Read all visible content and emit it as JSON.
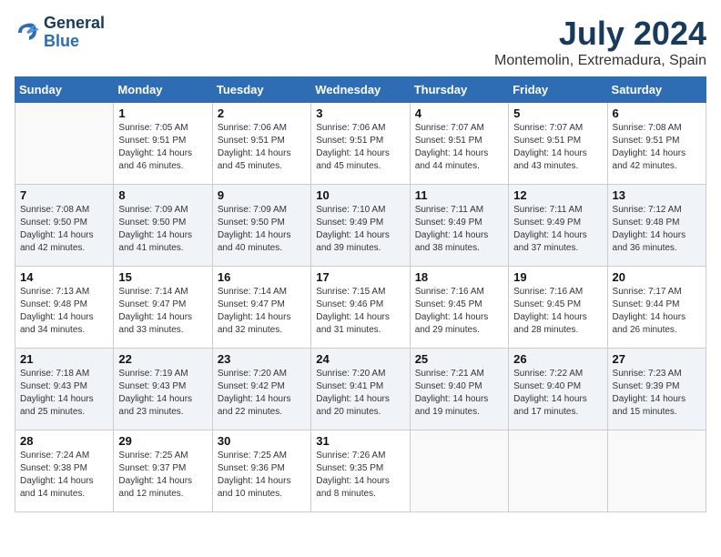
{
  "header": {
    "logo_line1": "General",
    "logo_line2": "Blue",
    "month_year": "July 2024",
    "location": "Montemolin, Extremadura, Spain"
  },
  "days_of_week": [
    "Sunday",
    "Monday",
    "Tuesday",
    "Wednesday",
    "Thursday",
    "Friday",
    "Saturday"
  ],
  "weeks": [
    [
      {
        "day": "",
        "info": ""
      },
      {
        "day": "1",
        "info": "Sunrise: 7:05 AM\nSunset: 9:51 PM\nDaylight: 14 hours\nand 46 minutes."
      },
      {
        "day": "2",
        "info": "Sunrise: 7:06 AM\nSunset: 9:51 PM\nDaylight: 14 hours\nand 45 minutes."
      },
      {
        "day": "3",
        "info": "Sunrise: 7:06 AM\nSunset: 9:51 PM\nDaylight: 14 hours\nand 45 minutes."
      },
      {
        "day": "4",
        "info": "Sunrise: 7:07 AM\nSunset: 9:51 PM\nDaylight: 14 hours\nand 44 minutes."
      },
      {
        "day": "5",
        "info": "Sunrise: 7:07 AM\nSunset: 9:51 PM\nDaylight: 14 hours\nand 43 minutes."
      },
      {
        "day": "6",
        "info": "Sunrise: 7:08 AM\nSunset: 9:51 PM\nDaylight: 14 hours\nand 42 minutes."
      }
    ],
    [
      {
        "day": "7",
        "info": "Sunrise: 7:08 AM\nSunset: 9:50 PM\nDaylight: 14 hours\nand 42 minutes."
      },
      {
        "day": "8",
        "info": "Sunrise: 7:09 AM\nSunset: 9:50 PM\nDaylight: 14 hours\nand 41 minutes."
      },
      {
        "day": "9",
        "info": "Sunrise: 7:09 AM\nSunset: 9:50 PM\nDaylight: 14 hours\nand 40 minutes."
      },
      {
        "day": "10",
        "info": "Sunrise: 7:10 AM\nSunset: 9:49 PM\nDaylight: 14 hours\nand 39 minutes."
      },
      {
        "day": "11",
        "info": "Sunrise: 7:11 AM\nSunset: 9:49 PM\nDaylight: 14 hours\nand 38 minutes."
      },
      {
        "day": "12",
        "info": "Sunrise: 7:11 AM\nSunset: 9:49 PM\nDaylight: 14 hours\nand 37 minutes."
      },
      {
        "day": "13",
        "info": "Sunrise: 7:12 AM\nSunset: 9:48 PM\nDaylight: 14 hours\nand 36 minutes."
      }
    ],
    [
      {
        "day": "14",
        "info": "Sunrise: 7:13 AM\nSunset: 9:48 PM\nDaylight: 14 hours\nand 34 minutes."
      },
      {
        "day": "15",
        "info": "Sunrise: 7:14 AM\nSunset: 9:47 PM\nDaylight: 14 hours\nand 33 minutes."
      },
      {
        "day": "16",
        "info": "Sunrise: 7:14 AM\nSunset: 9:47 PM\nDaylight: 14 hours\nand 32 minutes."
      },
      {
        "day": "17",
        "info": "Sunrise: 7:15 AM\nSunset: 9:46 PM\nDaylight: 14 hours\nand 31 minutes."
      },
      {
        "day": "18",
        "info": "Sunrise: 7:16 AM\nSunset: 9:45 PM\nDaylight: 14 hours\nand 29 minutes."
      },
      {
        "day": "19",
        "info": "Sunrise: 7:16 AM\nSunset: 9:45 PM\nDaylight: 14 hours\nand 28 minutes."
      },
      {
        "day": "20",
        "info": "Sunrise: 7:17 AM\nSunset: 9:44 PM\nDaylight: 14 hours\nand 26 minutes."
      }
    ],
    [
      {
        "day": "21",
        "info": "Sunrise: 7:18 AM\nSunset: 9:43 PM\nDaylight: 14 hours\nand 25 minutes."
      },
      {
        "day": "22",
        "info": "Sunrise: 7:19 AM\nSunset: 9:43 PM\nDaylight: 14 hours\nand 23 minutes."
      },
      {
        "day": "23",
        "info": "Sunrise: 7:20 AM\nSunset: 9:42 PM\nDaylight: 14 hours\nand 22 minutes."
      },
      {
        "day": "24",
        "info": "Sunrise: 7:20 AM\nSunset: 9:41 PM\nDaylight: 14 hours\nand 20 minutes."
      },
      {
        "day": "25",
        "info": "Sunrise: 7:21 AM\nSunset: 9:40 PM\nDaylight: 14 hours\nand 19 minutes."
      },
      {
        "day": "26",
        "info": "Sunrise: 7:22 AM\nSunset: 9:40 PM\nDaylight: 14 hours\nand 17 minutes."
      },
      {
        "day": "27",
        "info": "Sunrise: 7:23 AM\nSunset: 9:39 PM\nDaylight: 14 hours\nand 15 minutes."
      }
    ],
    [
      {
        "day": "28",
        "info": "Sunrise: 7:24 AM\nSunset: 9:38 PM\nDaylight: 14 hours\nand 14 minutes."
      },
      {
        "day": "29",
        "info": "Sunrise: 7:25 AM\nSunset: 9:37 PM\nDaylight: 14 hours\nand 12 minutes."
      },
      {
        "day": "30",
        "info": "Sunrise: 7:25 AM\nSunset: 9:36 PM\nDaylight: 14 hours\nand 10 minutes."
      },
      {
        "day": "31",
        "info": "Sunrise: 7:26 AM\nSunset: 9:35 PM\nDaylight: 14 hours\nand 8 minutes."
      },
      {
        "day": "",
        "info": ""
      },
      {
        "day": "",
        "info": ""
      },
      {
        "day": "",
        "info": ""
      }
    ]
  ]
}
